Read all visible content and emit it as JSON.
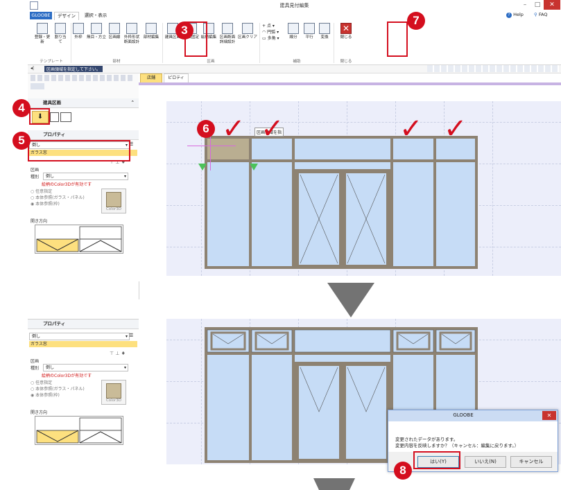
{
  "window": {
    "title": "建具見付編集",
    "help": "Help",
    "faq": "FAQ",
    "minimize": "–",
    "maximize": "□",
    "close": "✕"
  },
  "tabs": [
    {
      "label": "GLOOBE"
    },
    {
      "label": "デザイン"
    },
    {
      "label": "選択・表示"
    }
  ],
  "ribbon": {
    "buttons": [
      "登録・更新",
      "割り当て",
      "外枠",
      "無目・方立",
      "区画線",
      "外枠形状\n断面設計",
      "部材編集",
      "建具区画",
      "寸法固定",
      "絵柄編集",
      "区画断面\n詳細設計",
      "区画クリア",
      "点",
      "円弧",
      "多角",
      "線分",
      "平行",
      "変換",
      "閉じる"
    ],
    "groups": [
      "テンプレート",
      "部材",
      "区画",
      "補助",
      "閉じる"
    ]
  },
  "status_hint": "区画領域を指定して下さい。",
  "canvas_tabs": [
    "店舗",
    "ピロティ"
  ],
  "tooltip": "区画領域を指",
  "panel_top": {
    "section": "建具区画"
  },
  "properties": {
    "header": "プロパティ",
    "type_value": "倒し",
    "material_value": "ガラス窓",
    "zone_label": "区画",
    "kind_label": "種別",
    "kind_value": "倒し",
    "notice": "絵柄のColor3Dが有効です",
    "options": [
      "任意指定",
      "本体参照(ガラス・パネル)",
      "本体参照(枠)"
    ],
    "color_label": "Color3D",
    "opening_label": "開き方向"
  },
  "dialog": {
    "title": "GLOOBE",
    "close": "✕",
    "message1": "変更されたデータがあります。",
    "message2": "変更内容を反映しますか？（キャンセル：編集に戻ります。）",
    "yes": "はい(Y)",
    "no": "いいえ(N)",
    "cancel": "キャンセル"
  },
  "callouts": [
    "3",
    "4",
    "5",
    "6",
    "7",
    "8"
  ],
  "checkmark": "✓",
  "colors": {
    "accent_red": "#d40e1e",
    "tab_blue": "#2b6cc4",
    "glass": "#c6dcf6",
    "frame": "#8d8272",
    "highlight": "#fde07f"
  }
}
